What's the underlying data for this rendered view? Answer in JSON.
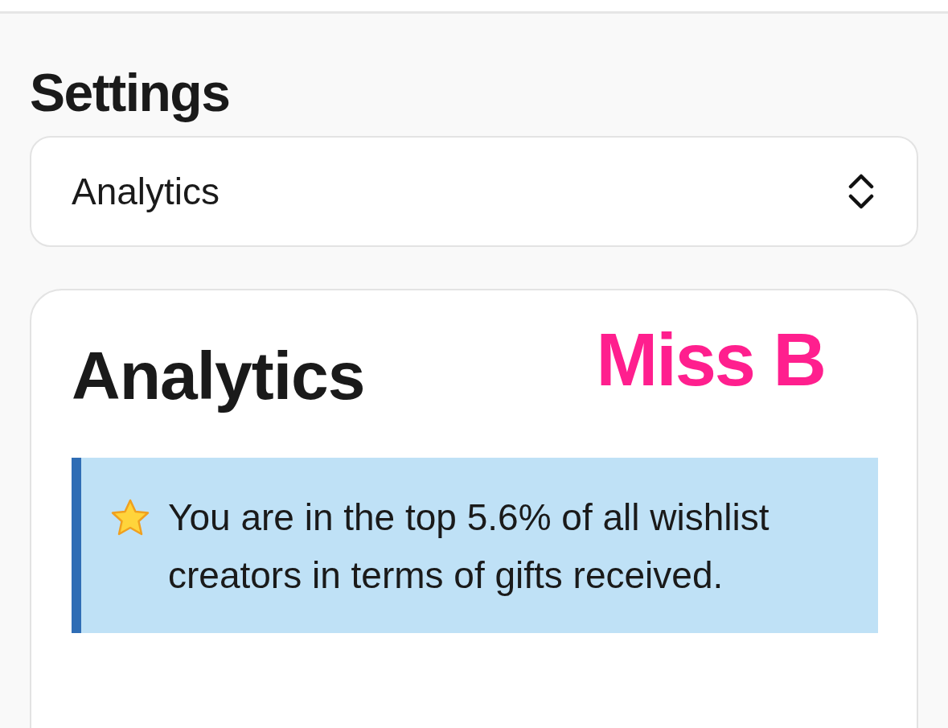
{
  "page_title": "Settings",
  "section_select": {
    "value": "Analytics"
  },
  "card": {
    "title": "Analytics",
    "overlay_label": "Miss B",
    "callout": {
      "text": "You are in the top 5.6% of all wishlist creators in terms of gifts received."
    }
  }
}
